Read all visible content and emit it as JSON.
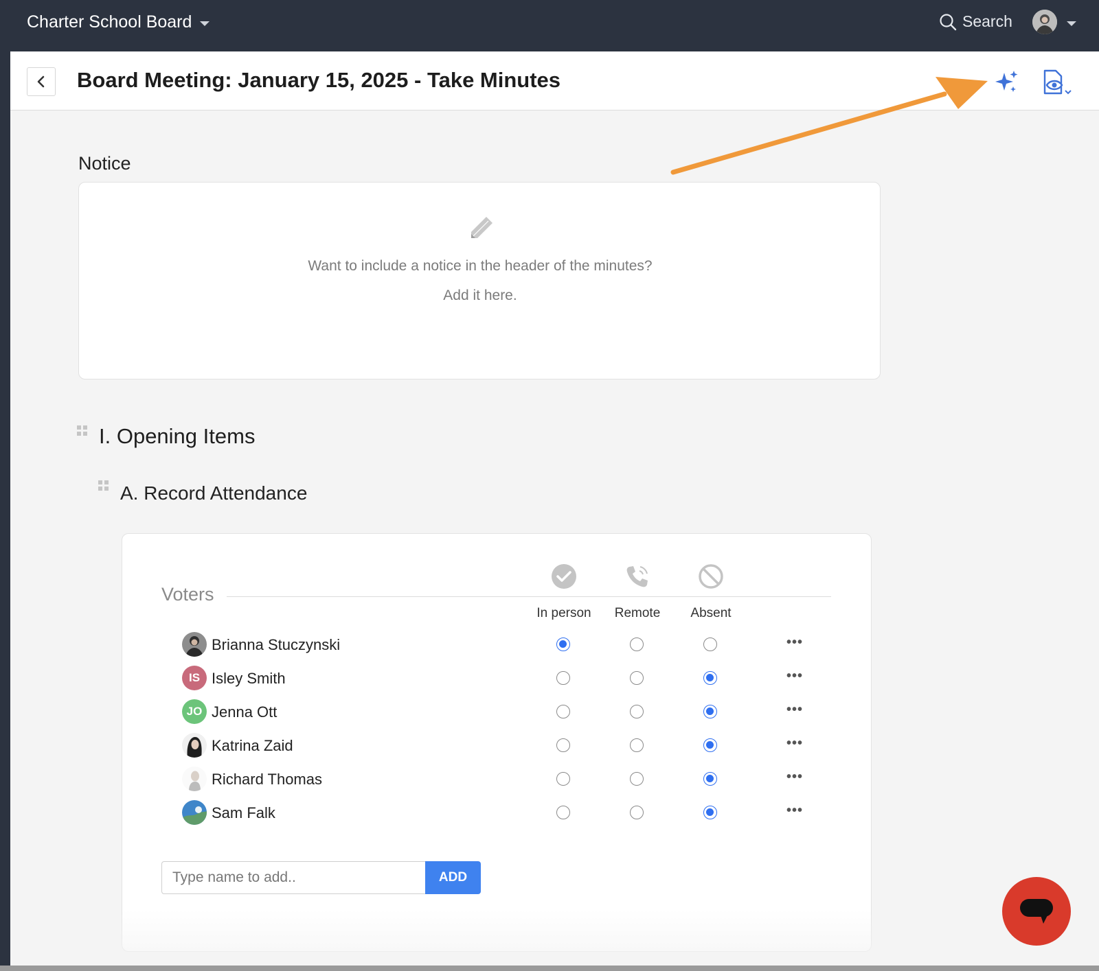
{
  "topbar": {
    "org_name": "Charter School Board",
    "search_label": "Search"
  },
  "header": {
    "title": "Board Meeting: January 15, 2025 - Take Minutes"
  },
  "notice": {
    "label": "Notice",
    "line1": "Want to include a notice in the header of the minutes?",
    "line2": "Add it here."
  },
  "sections": {
    "section_title": "I. Opening Items",
    "subsection_title": "A. Record Attendance"
  },
  "attendance": {
    "voters_label": "Voters",
    "columns": [
      "In person",
      "Remote",
      "Absent"
    ],
    "rows": [
      {
        "name": "Brianna Stuczynski",
        "initials": "",
        "status": "In person"
      },
      {
        "name": "Isley Smith",
        "initials": "IS",
        "status": "Absent"
      },
      {
        "name": "Jenna Ott",
        "initials": "JO",
        "status": "Absent"
      },
      {
        "name": "Katrina Zaid",
        "initials": "",
        "status": "Absent"
      },
      {
        "name": "Richard Thomas",
        "initials": "",
        "status": "Absent"
      },
      {
        "name": "Sam Falk",
        "initials": "",
        "status": "Absent"
      }
    ],
    "more_label": "•••",
    "add_placeholder": "Type name to add..",
    "add_button": "ADD"
  },
  "colors": {
    "topbar": "#2c3340",
    "accent": "#3f82ef",
    "annotation_arrow": "#f0993a",
    "chat": "#d93a2b"
  },
  "icons": {
    "ai": "sparkles-icon",
    "preview": "document-eye-icon",
    "notice": "pencil-icon",
    "in_person": "check-circle-icon",
    "remote": "phone-icon",
    "absent": "ban-icon"
  }
}
